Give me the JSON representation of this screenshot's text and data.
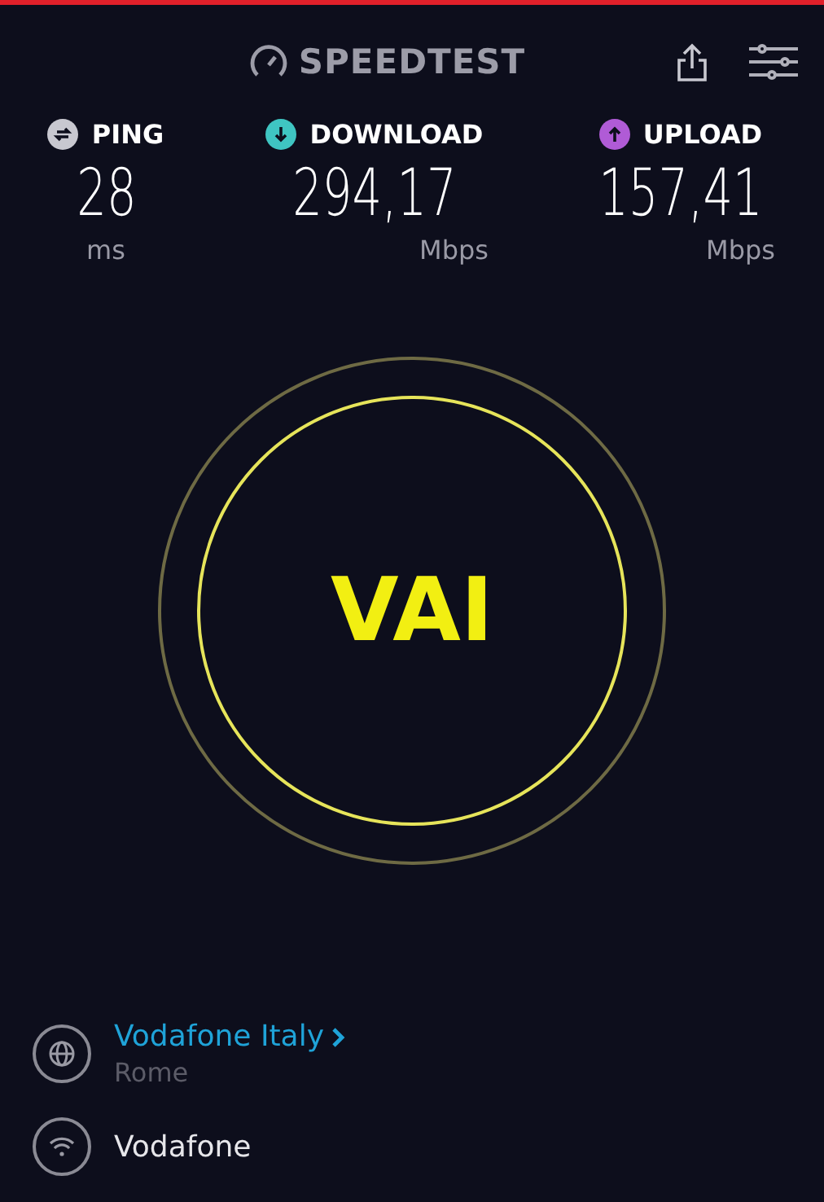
{
  "header": {
    "logo": "SPEEDTEST"
  },
  "metrics": [
    {
      "kind": "ping",
      "label": "PING",
      "value": "28",
      "unit": "ms",
      "color": "#c8c8d0"
    },
    {
      "kind": "download",
      "label": "DOWNLOAD",
      "value": "294,17",
      "unit": "Mbps",
      "color": "#3fc5c2"
    },
    {
      "kind": "upload",
      "label": "UPLOAD",
      "value": "157,41",
      "unit": "Mbps",
      "color": "#b05bd6"
    }
  ],
  "start_button": {
    "label": "VAI"
  },
  "connections": [
    {
      "kind": "server",
      "name": "Vodafone Italy",
      "location": "Rome"
    },
    {
      "kind": "network",
      "name": "Vodafone"
    }
  ]
}
